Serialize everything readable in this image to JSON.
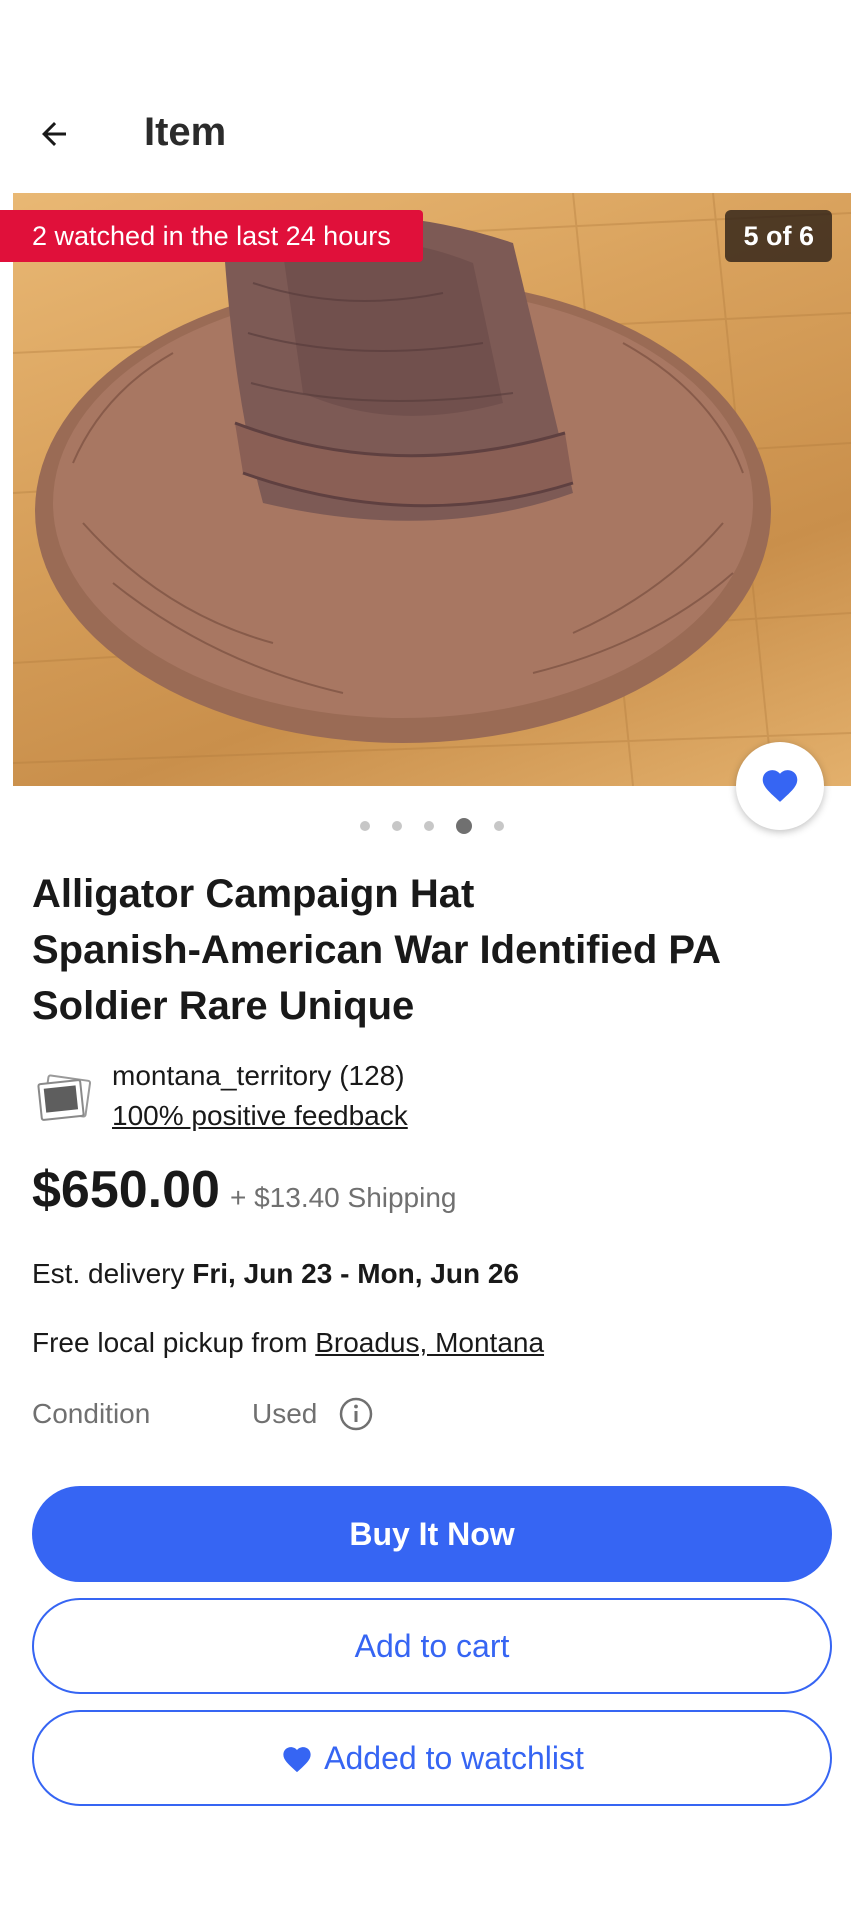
{
  "header": {
    "title": "Item"
  },
  "gallery": {
    "watch_banner": "2 watched in the last 24 hours",
    "counter": "5 of 6",
    "dots_total": 5,
    "dots_active_index": 3
  },
  "item": {
    "title": "Alligator Campaign Hat Spanish-American War Identified PA Soldier Rare Unique",
    "title_lines": [
      "Alligator Campaign Hat",
      "Spanish-American War Identified PA",
      "Soldier Rare Unique"
    ]
  },
  "seller": {
    "name": "montana_territory (128)",
    "feedback": "100% positive feedback"
  },
  "pricing": {
    "price": "$650.00",
    "shipping": "+ $13.40 Shipping"
  },
  "delivery": {
    "label": "Est. delivery",
    "dates": "Fri, Jun 23 - Mon, Jun 26"
  },
  "pickup": {
    "label": "Free local pickup from",
    "location": "Broadus, Montana"
  },
  "condition": {
    "label": "Condition",
    "value": "Used"
  },
  "actions": {
    "buy_now": "Buy It Now",
    "add_to_cart": "Add to cart",
    "watchlist": "Added to watchlist"
  },
  "icons": {
    "back": "arrow-left-icon",
    "watch": "heart-icon",
    "info": "info-icon",
    "seller_avatar": "photo-icon"
  },
  "colors": {
    "primary": "#3665f3",
    "watch_banner": "#e0103a",
    "text": "#191919",
    "secondary_text": "#707070"
  }
}
